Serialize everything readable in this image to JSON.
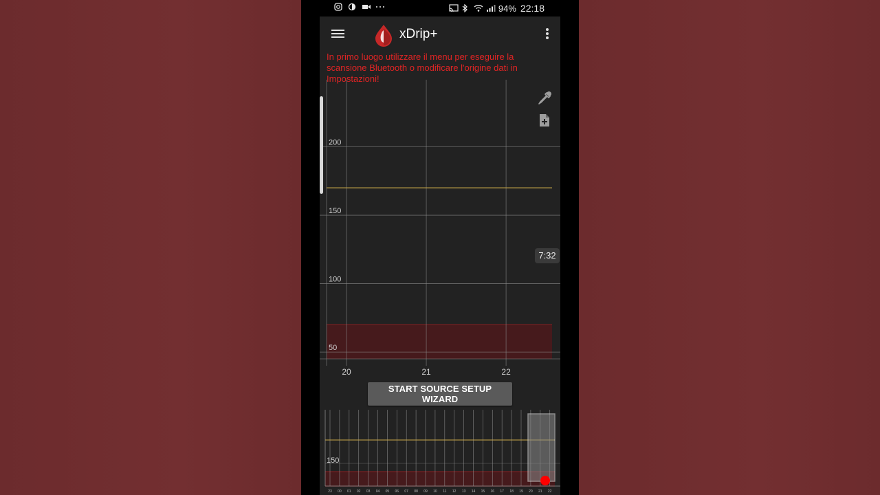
{
  "colors": {
    "background": "#6e2d2f",
    "app_bg": "#222222",
    "warning_text": "#e02424",
    "target_line": "#c9a84a",
    "low_band": "#4a1a1c",
    "grid": "#8a8a8a",
    "accent_red": "#ff0000"
  },
  "status_bar": {
    "battery": "94%",
    "time": "22:18",
    "left_icons": [
      "instagram-icon",
      "data-saver-icon",
      "video-icon",
      "more-icon"
    ],
    "right_icons": [
      "cast-icon",
      "bluetooth-icon",
      "wifi-icon",
      "signal-icon"
    ]
  },
  "toolbar": {
    "title": "xDrip+",
    "menu_icon": "hamburger-menu-icon",
    "logo_icon": "blood-drop-icon",
    "overflow_icon": "overflow-menu-icon"
  },
  "notice": {
    "text": "In primo luogo utilizzare il menu per eseguire la scansione Bluetooth o modificare l'origine dati in Impostazioni!"
  },
  "side_icons": [
    "eyedropper-icon",
    "add-note-icon"
  ],
  "time_badge": "7:32",
  "main_chart": {
    "y_ticks": [
      "200",
      "150",
      "100",
      "50"
    ],
    "y_tick_values": [
      200,
      150,
      100,
      50
    ],
    "x_ticks": [
      "20",
      "21",
      "22"
    ],
    "x_tick_values": [
      20,
      21,
      22
    ],
    "high_target": 170,
    "low_target": 70,
    "y_range": [
      40,
      250
    ],
    "x_range": [
      19.75,
      22.68
    ]
  },
  "wizard_button": {
    "label": "START SOURCE SETUP WIZARD"
  },
  "mini_chart": {
    "y_ticks": [
      "150"
    ],
    "x_ticks": [
      "23",
      "00",
      "01",
      "02",
      "03",
      "04",
      "05",
      "06",
      "07",
      "08",
      "09",
      "10",
      "11",
      "12",
      "13",
      "14",
      "15",
      "16",
      "17",
      "18",
      "19",
      "20",
      "21",
      "22"
    ],
    "high_target": 150,
    "low_target": 70
  }
}
